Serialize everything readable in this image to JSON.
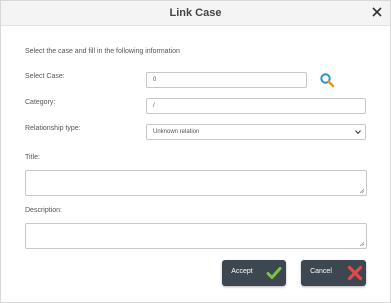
{
  "dialog": {
    "title": "Link Case",
    "close_glyph": "✕"
  },
  "form": {
    "instruction": "Select the case and fill in the following information",
    "select_case": {
      "label": "Select Case:",
      "value": "0",
      "icon": "search-icon"
    },
    "category": {
      "label": "Category:",
      "value": "/"
    },
    "relationship": {
      "label": "Relationship type:",
      "selected": "Unknown relation"
    },
    "title": {
      "label": "Title:",
      "value": ""
    },
    "description": {
      "label": "Description:",
      "value": ""
    }
  },
  "buttons": {
    "accept": {
      "label": "Accept",
      "icon": "check-icon",
      "icon_color": "#7dc243"
    },
    "cancel": {
      "label": "Cancel",
      "icon": "x-icon",
      "icon_color": "#e04a4a"
    }
  },
  "colors": {
    "button_bg": "#3d4750",
    "search_icon": "#2b8fd6"
  }
}
